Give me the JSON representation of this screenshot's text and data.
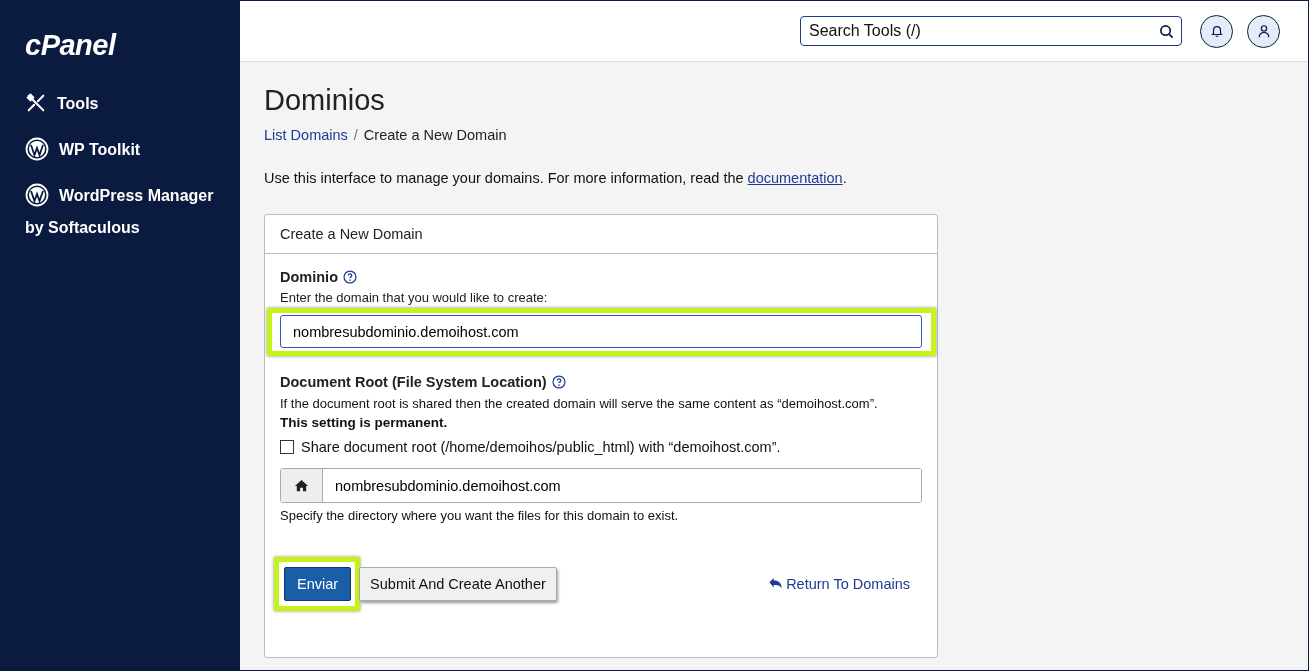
{
  "sidebar": {
    "logo": "cPanel",
    "items": [
      {
        "label": "Tools",
        "kind": "tools"
      },
      {
        "label": "WP Toolkit",
        "kind": "wordpress"
      },
      {
        "label": "WordPress Manager by Softaculous",
        "kind": "wordpress"
      }
    ]
  },
  "header": {
    "search": {
      "placeholder": "Search Tools (/)"
    }
  },
  "page": {
    "title": "Dominios",
    "breadcrumb_separator": "/",
    "breadcrumbs": [
      {
        "label": "List Domains",
        "kind": "link"
      },
      {
        "label": "Create a New Domain",
        "kind": "current"
      }
    ],
    "intro": {
      "text": "Use this interface to manage your domains. For more information, read the ",
      "link": "documentation",
      "after": "."
    }
  },
  "panel": {
    "title": "Create a New Domain",
    "domain": {
      "label": "Dominio",
      "hint": "Enter the domain that you would like to create:",
      "value": "nombresubdominio.demoihost.com",
      "highlighted": true
    },
    "document_root": {
      "label": "Document Root (File System Location)",
      "description": "If the document root is shared then the created domain will serve the same content as “demoihost.com”.",
      "warning": "This setting is permanent.",
      "share_checkbox": {
        "label": "Share document root (/home/demoihos/public_html) with “demoihost.com”.",
        "checked": false
      },
      "path": {
        "value": "nombresubdominio.demoihost.com"
      },
      "note": "Specify the directory where you want the files for this domain to exist."
    },
    "buttons": [
      {
        "label": "Enviar",
        "kind": "primary",
        "highlighted": true
      },
      {
        "label": "Submit And Create Another",
        "kind": "secondary",
        "highlighted": false
      }
    ],
    "return_link": "Return To Domains"
  }
}
